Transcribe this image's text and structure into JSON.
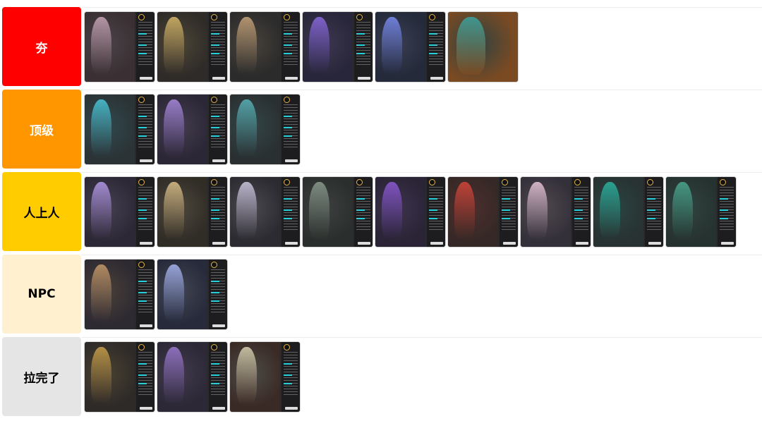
{
  "tiers": [
    {
      "label": "夯",
      "color": "#ff0000",
      "text_color": "#ffffff",
      "cards": [
        {
          "art": "#3a3034",
          "figure": "#c9a6b8"
        },
        {
          "art": "#2f2b28",
          "figure": "#d8b86a"
        },
        {
          "art": "#2b2b2b",
          "figure": "#c7a47a"
        },
        {
          "art": "#28263a",
          "figure": "#8a6adf"
        },
        {
          "art": "#242a3a",
          "figure": "#7a8cf0"
        },
        {
          "art": "#7a4a22",
          "figure": "#3aa3a0",
          "wide": true
        }
      ]
    },
    {
      "label": "顶级",
      "color": "#ff9600",
      "text_color": "#ffffff",
      "cards": [
        {
          "art": "#2b3336",
          "figure": "#4ac6d8"
        },
        {
          "art": "#2c2736",
          "figure": "#a98ae0"
        },
        {
          "art": "#2a3032",
          "figure": "#58b3b8"
        }
      ]
    },
    {
      "label": "人上人",
      "color": "#ffcc00",
      "text_color": "#000000",
      "cards": [
        {
          "art": "#2d2836",
          "figure": "#b59ae8"
        },
        {
          "art": "#302c26",
          "figure": "#dcc08a"
        },
        {
          "art": "#2c2b31",
          "figure": "#d0c9e2"
        },
        {
          "art": "#2a2e2c",
          "figure": "#8a9a8e"
        },
        {
          "art": "#2a2436",
          "figure": "#8c5ad6"
        },
        {
          "art": "#362826",
          "figure": "#d4463a"
        },
        {
          "art": "#34303a",
          "figure": "#e8c6da"
        },
        {
          "art": "#283232",
          "figure": "#2bb3a0"
        },
        {
          "art": "#263230",
          "figure": "#4aa890"
        }
      ]
    },
    {
      "label": "NPC",
      "color": "#fff1cf",
      "text_color": "#000000",
      "cards": [
        {
          "art": "#2e2a32",
          "figure": "#c69a6a"
        },
        {
          "art": "#262a3a",
          "figure": "#a8b6f0"
        }
      ]
    },
    {
      "label": "拉完了",
      "color": "#e5e5e5",
      "text_color": "#000000",
      "cards": [
        {
          "art": "#2e2a28",
          "figure": "#caa04a"
        },
        {
          "art": "#2c2836",
          "figure": "#9c7ad0"
        },
        {
          "art": "#3a2a26",
          "figure": "#d8d2b2"
        }
      ]
    }
  ]
}
